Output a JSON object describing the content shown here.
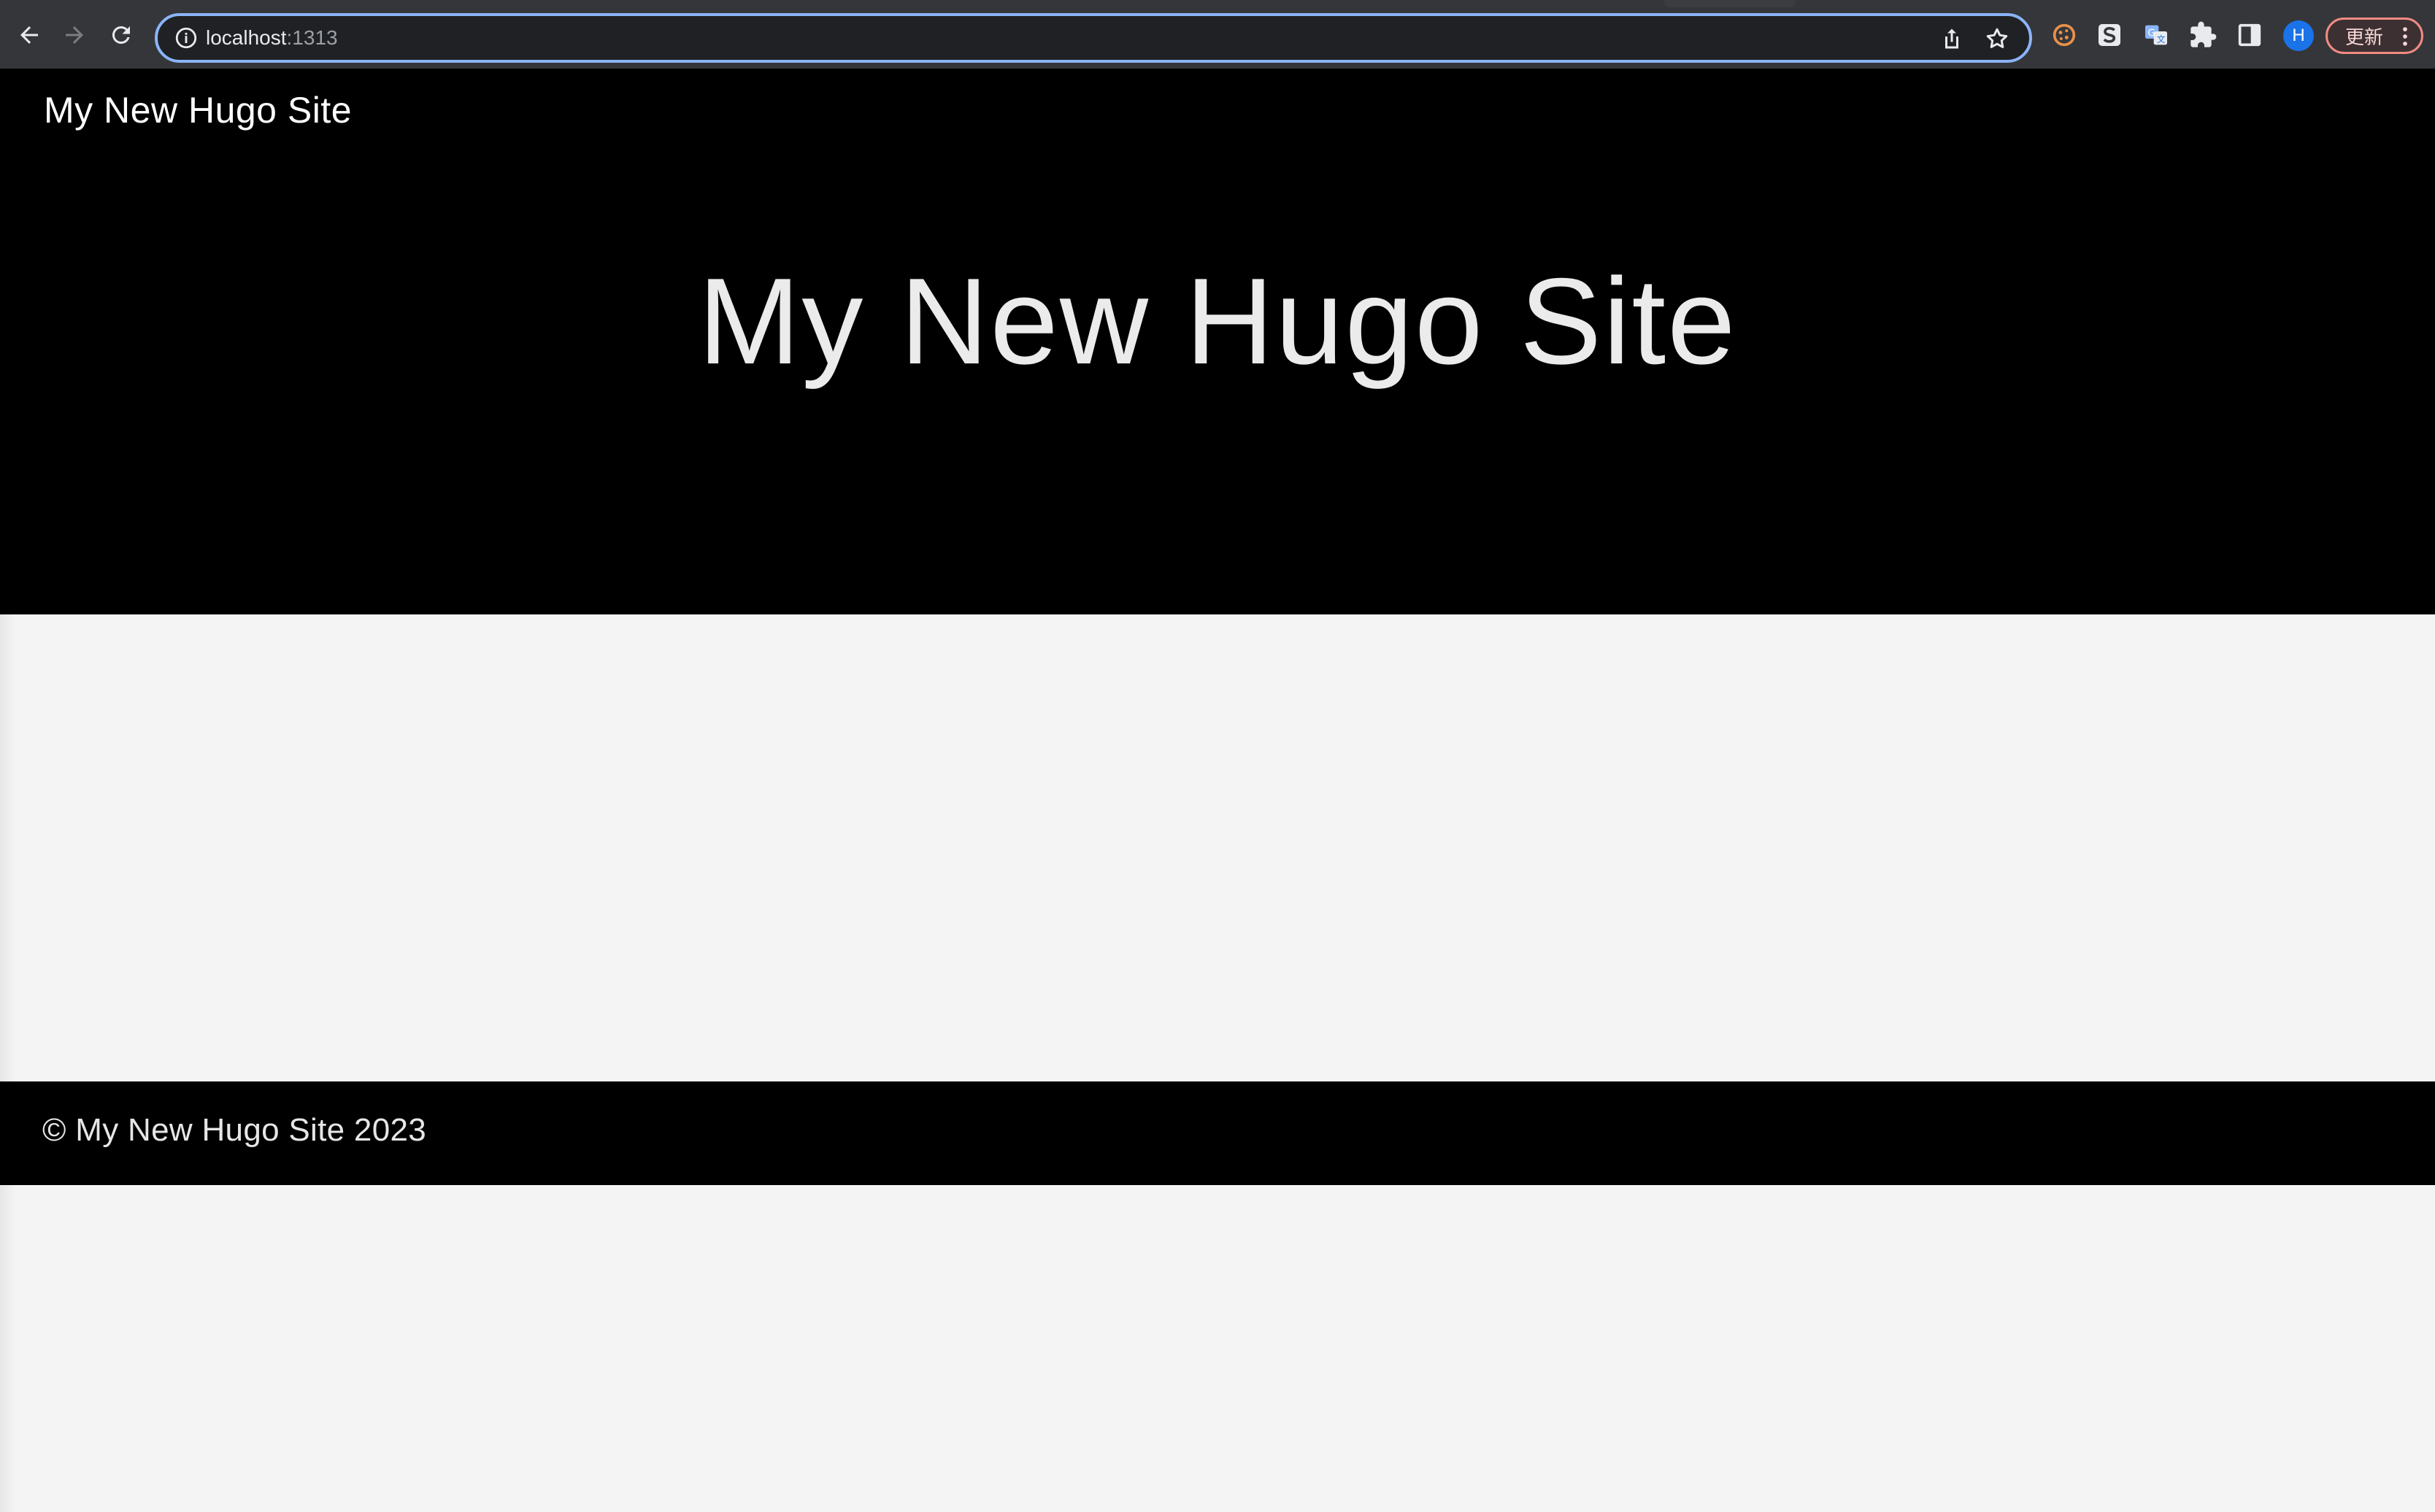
{
  "browser": {
    "url_host": "localhost",
    "url_port": ":1313",
    "profile_initial": "H",
    "update_label": "更新",
    "icons": {
      "back": "arrow-left-icon",
      "forward": "arrow-right-icon",
      "reload": "reload-icon",
      "site_info": "info-icon",
      "share": "share-icon",
      "bookmark": "star-icon",
      "ext_cookie": "cookie-icon",
      "ext_s": "s-extension-icon",
      "ext_translate": "translate-icon",
      "extensions": "puzzle-icon",
      "side_panel": "side-panel-icon",
      "menu": "more-vert-icon"
    }
  },
  "site": {
    "nav_title": "My New Hugo Site",
    "hero_title": "My New Hugo Site",
    "footer_text": "© My New Hugo Site 2023"
  },
  "colors": {
    "header_bg": "#000000",
    "page_bg": "#f4f4f4",
    "chrome_bg": "#35363a",
    "omnibox_focus": "#8ab4f8",
    "update_accent": "#f28b82"
  }
}
